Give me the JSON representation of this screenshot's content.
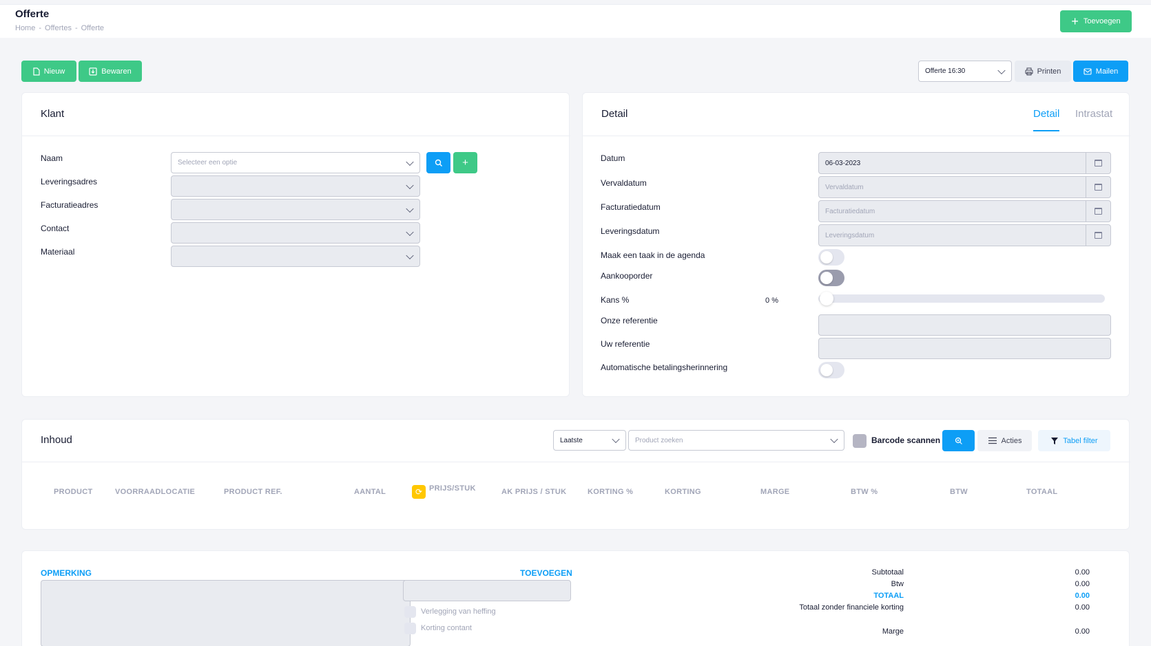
{
  "header": {
    "title": "Offerte",
    "breadcrumb": [
      "Home",
      "Offertes",
      "Offerte"
    ],
    "add_button": "Toevoegen"
  },
  "toolbar": {
    "new_button": "Nieuw",
    "save_button": "Bewaren",
    "template_select": "Offerte 16:30",
    "print_button": "Printen",
    "mail_button": "Mailen"
  },
  "klant": {
    "title": "Klant",
    "fields": [
      {
        "label": "Naam",
        "placeholder": "Selecteer een optie"
      },
      {
        "label": "Leveringsadres",
        "placeholder": ""
      },
      {
        "label": "Facturatieadres",
        "placeholder": ""
      },
      {
        "label": "Contact",
        "placeholder": ""
      },
      {
        "label": "Materiaal",
        "placeholder": ""
      }
    ]
  },
  "detail": {
    "title": "Detail",
    "tabs": [
      "Detail",
      "Intrastat"
    ],
    "active_tab": "Detail",
    "datum_label": "Datum",
    "datum_value": "06-03-2023",
    "vervaldatum_label": "Vervaldatum",
    "vervaldatum_placeholder": "Vervaldatum",
    "facturatiedatum_label": "Facturatiedatum",
    "facturatiedatum_placeholder": "Facturatiedatum",
    "leveringsdatum_label": "Leveringsdatum",
    "leveringsdatum_placeholder": "Leveringsdatum",
    "taak_label": "Maak een taak in de agenda",
    "taak_on": false,
    "aankooporder_label": "Aankooporder",
    "aankooporder_on": false,
    "kans_label": "Kans %",
    "kans_value": "0",
    "kans_unit": "%",
    "onze_ref_label": "Onze referentie",
    "uw_ref_label": "Uw referentie",
    "auto_herinnering_label": "Automatische betalingsherinnering",
    "auto_herinnering_on": false
  },
  "inhoud": {
    "title": "Inhoud",
    "sort_select": "Laatste",
    "product_search_placeholder": "Product zoeken",
    "barcode_label": "Barcode scannen",
    "actions_button": "Acties",
    "filter_button": "Tabel filter",
    "columns": [
      "PRODUCT",
      "VOORRAADLOCATIE",
      "PRODUCT REF.",
      "AANTAL",
      "PRIJS/STUK",
      "AK PRIJS / STUK",
      "KORTING %",
      "KORTING",
      "MARGE",
      "BTW %",
      "BTW",
      "TOTAAL"
    ]
  },
  "footer": {
    "opmerking_label": "OPMERKING",
    "toevoegen_label": "TOEVOEGEN",
    "verlegging_label": "Verlegging van heffing",
    "korting_contant_label": "Korting contant",
    "totals": [
      {
        "label": "Subtotaal",
        "value": "0.00"
      },
      {
        "label": "Btw",
        "value": "0.00"
      },
      {
        "label": "TOTAAL",
        "value": "0.00"
      },
      {
        "label": "Totaal zonder financiele korting",
        "value": "0.00"
      },
      {
        "label": "Marge",
        "value": "0.00"
      }
    ]
  }
}
